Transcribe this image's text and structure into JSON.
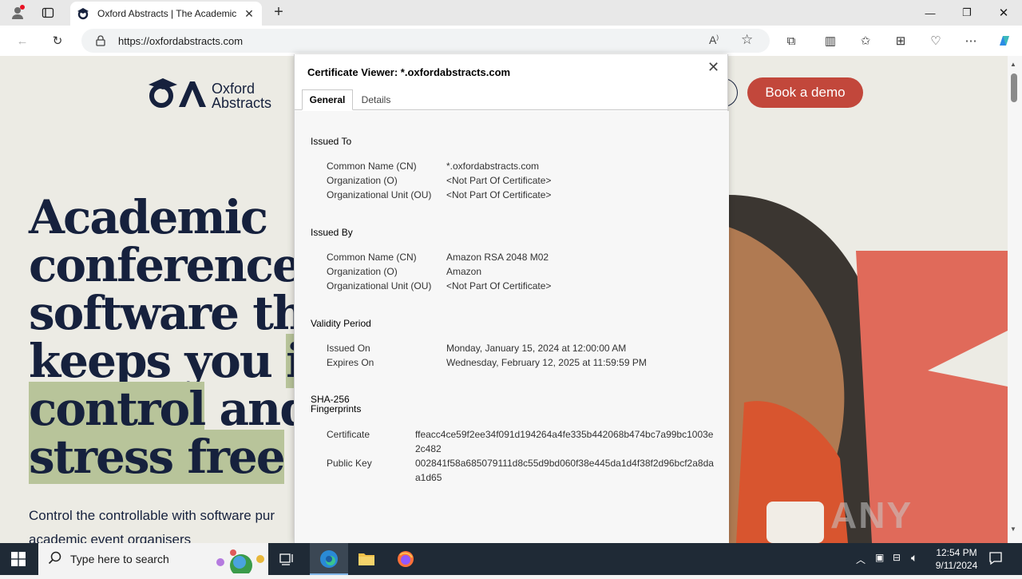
{
  "browser": {
    "tab_title": "Oxford Abstracts | The Academic",
    "url": "https://oxfordabstracts.com"
  },
  "page": {
    "logo_line1": "Oxford",
    "logo_line2": "Abstracts",
    "book_demo": "Book a demo",
    "hero": {
      "line1": "Academic",
      "line2": "conference",
      "line3": "software tha",
      "line4a": "keeps you ",
      "line4b": "in",
      "line5a": "control",
      "line5b": " and",
      "line6": "stress free"
    },
    "subtitle_line1": "Control the controllable with software pur",
    "subtitle_line2": "academic event organisers",
    "watermark": "ANY RUN"
  },
  "dialog": {
    "title": "Certificate Viewer: *.oxfordabstracts.com",
    "tabs": [
      "General",
      "Details"
    ],
    "issued_to": {
      "heading": "Issued To",
      "cn_label": "Common Name (CN)",
      "cn_value": "*.oxfordabstracts.com",
      "o_label": "Organization (O)",
      "o_value": "<Not Part Of Certificate>",
      "ou_label": "Organizational Unit (OU)",
      "ou_value": "<Not Part Of Certificate>"
    },
    "issued_by": {
      "heading": "Issued By",
      "cn_label": "Common Name (CN)",
      "cn_value": "Amazon RSA 2048 M02",
      "o_label": "Organization (O)",
      "o_value": "Amazon",
      "ou_label": "Organizational Unit (OU)",
      "ou_value": "<Not Part Of Certificate>"
    },
    "validity": {
      "heading": "Validity Period",
      "issued_label": "Issued On",
      "issued_value": "Monday, January 15, 2024 at 12:00:00 AM",
      "expires_label": "Expires On",
      "expires_value": "Wednesday, February 12, 2025 at 11:59:59 PM"
    },
    "fingerprints": {
      "heading_line1": "SHA-256",
      "heading_line2": "Fingerprints",
      "cert_label": "Certificate",
      "cert_value": "ffeacc4ce59f2ee34f091d194264a4fe335b442068b474bc7a99bc1003e2c482",
      "pk_label": "Public Key",
      "pk_value": "002841f58a685079111d8c55d9bd060f38e445da1d4f38f2d96bcf2a8daa1d65"
    }
  },
  "taskbar": {
    "search_placeholder": "Type here to search",
    "time": "12:54 PM",
    "date": "9/11/2024"
  },
  "colors": {
    "accent_button": "#c2473b",
    "hero_text": "#16213d",
    "highlight": "#b8c49a",
    "page_bg": "#ecebe4"
  }
}
